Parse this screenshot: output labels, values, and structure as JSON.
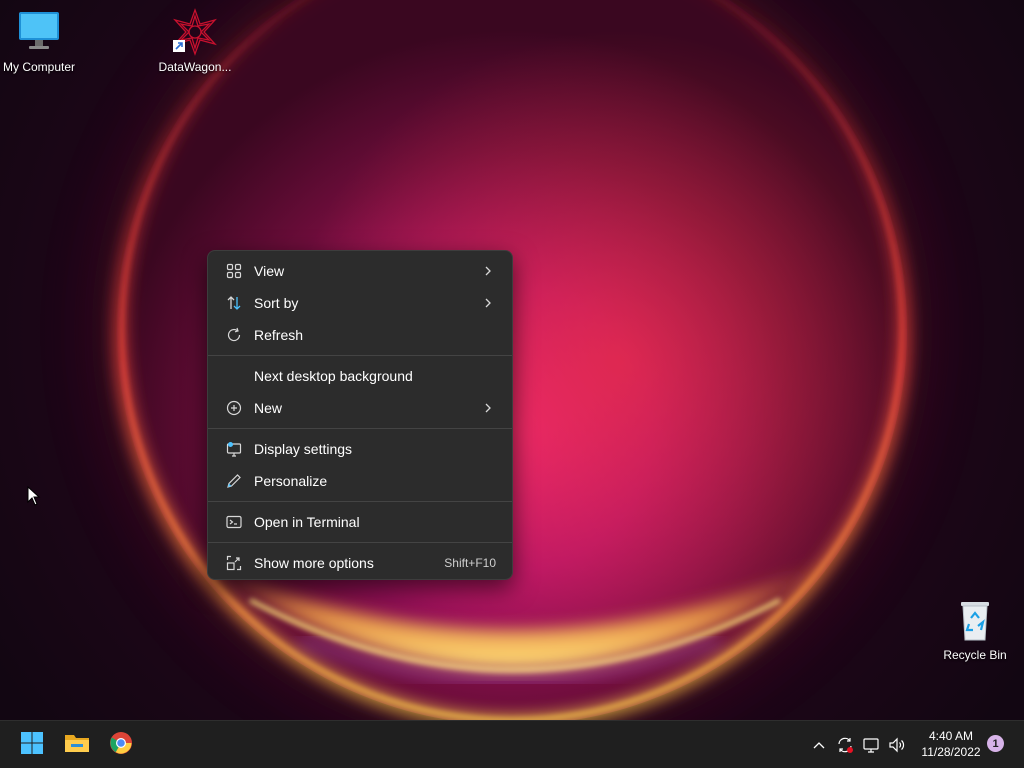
{
  "desktop": {
    "icons": [
      {
        "label": "My Computer"
      },
      {
        "label": "DataWagon..."
      },
      {
        "label": "Recycle Bin"
      }
    ]
  },
  "context_menu": {
    "items": [
      {
        "label": "View",
        "icon": "grid-view-icon",
        "has_submenu": true
      },
      {
        "label": "Sort by",
        "icon": "sort-icon",
        "has_submenu": true
      },
      {
        "label": "Refresh",
        "icon": "refresh-icon"
      },
      {
        "label": "Next desktop background"
      },
      {
        "label": "New",
        "icon": "plus-circle-icon",
        "has_submenu": true
      },
      {
        "label": "Display settings",
        "icon": "monitor-settings-icon"
      },
      {
        "label": "Personalize",
        "icon": "pen-icon"
      },
      {
        "label": "Open in Terminal",
        "icon": "terminal-icon"
      },
      {
        "label": "Show more options",
        "icon": "expand-icon",
        "shortcut": "Shift+F10"
      }
    ]
  },
  "taskbar": {
    "pinned": [
      {
        "name": "start-button",
        "icon": "windows-logo-icon"
      },
      {
        "name": "file-explorer",
        "icon": "folder-icon"
      },
      {
        "name": "chrome",
        "icon": "chrome-icon"
      }
    ],
    "tray": [
      "chevron-up-icon",
      "sync-icon",
      "network-icon",
      "volume-icon"
    ],
    "clock": {
      "time": "4:40 AM",
      "date": "11/28/2022"
    },
    "notification_count": "1"
  },
  "colors": {
    "menu_bg": "#2c2c2c",
    "taskbar_bg": "#1f1f1f",
    "accent_blue": "#4cc2ff"
  }
}
